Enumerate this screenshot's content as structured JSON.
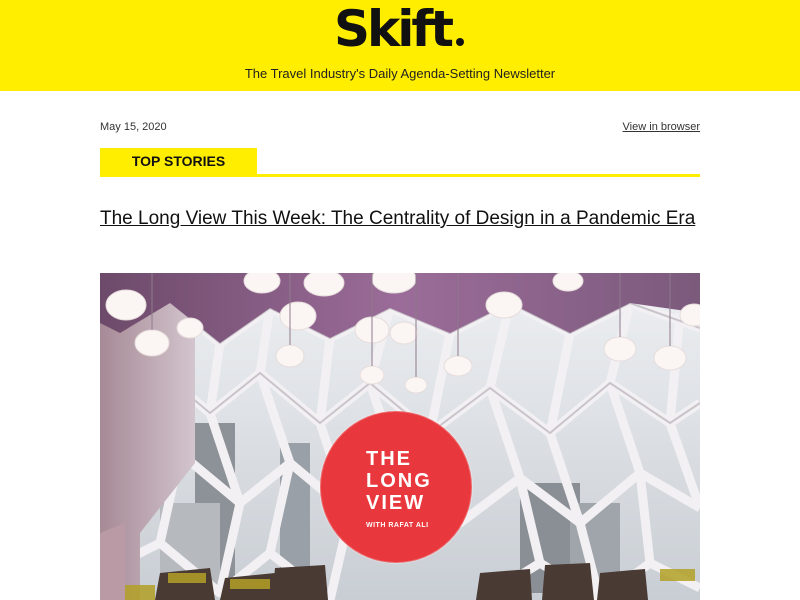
{
  "header": {
    "logo_text": "Skift",
    "tagline": "The Travel Industry's Daily Agenda-Setting Newsletter",
    "brand_color": "#ffee00"
  },
  "meta": {
    "date": "May 15, 2020",
    "view_in_browser": "View in browser"
  },
  "section": {
    "label": "TOP STORIES"
  },
  "article": {
    "headline": "The Long View This Week: The Centrality of Design in a Pandemic Era",
    "image": {
      "badge_lines": [
        "THE",
        "LONG",
        "VIEW"
      ],
      "badge_byline": "WITH RAFAT ALI",
      "badge_color": "#e8383d"
    }
  }
}
